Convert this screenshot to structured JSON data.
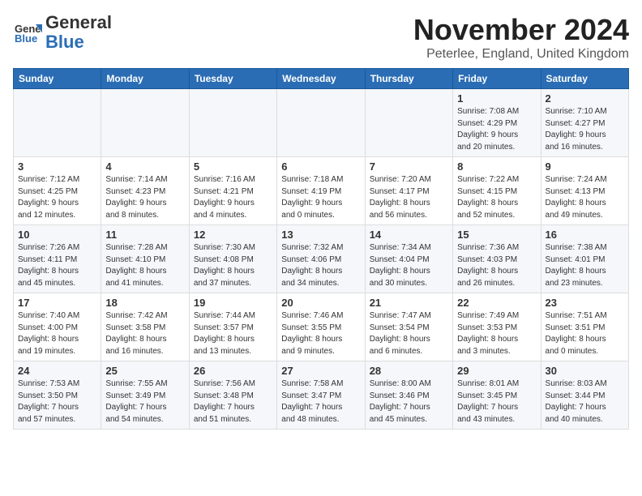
{
  "logo": {
    "line1": "General",
    "line2": "Blue"
  },
  "title": "November 2024",
  "location": "Peterlee, England, United Kingdom",
  "weekdays": [
    "Sunday",
    "Monday",
    "Tuesday",
    "Wednesday",
    "Thursday",
    "Friday",
    "Saturday"
  ],
  "weeks": [
    [
      {
        "day": "",
        "info": ""
      },
      {
        "day": "",
        "info": ""
      },
      {
        "day": "",
        "info": ""
      },
      {
        "day": "",
        "info": ""
      },
      {
        "day": "",
        "info": ""
      },
      {
        "day": "1",
        "info": "Sunrise: 7:08 AM\nSunset: 4:29 PM\nDaylight: 9 hours\nand 20 minutes."
      },
      {
        "day": "2",
        "info": "Sunrise: 7:10 AM\nSunset: 4:27 PM\nDaylight: 9 hours\nand 16 minutes."
      }
    ],
    [
      {
        "day": "3",
        "info": "Sunrise: 7:12 AM\nSunset: 4:25 PM\nDaylight: 9 hours\nand 12 minutes."
      },
      {
        "day": "4",
        "info": "Sunrise: 7:14 AM\nSunset: 4:23 PM\nDaylight: 9 hours\nand 8 minutes."
      },
      {
        "day": "5",
        "info": "Sunrise: 7:16 AM\nSunset: 4:21 PM\nDaylight: 9 hours\nand 4 minutes."
      },
      {
        "day": "6",
        "info": "Sunrise: 7:18 AM\nSunset: 4:19 PM\nDaylight: 9 hours\nand 0 minutes."
      },
      {
        "day": "7",
        "info": "Sunrise: 7:20 AM\nSunset: 4:17 PM\nDaylight: 8 hours\nand 56 minutes."
      },
      {
        "day": "8",
        "info": "Sunrise: 7:22 AM\nSunset: 4:15 PM\nDaylight: 8 hours\nand 52 minutes."
      },
      {
        "day": "9",
        "info": "Sunrise: 7:24 AM\nSunset: 4:13 PM\nDaylight: 8 hours\nand 49 minutes."
      }
    ],
    [
      {
        "day": "10",
        "info": "Sunrise: 7:26 AM\nSunset: 4:11 PM\nDaylight: 8 hours\nand 45 minutes."
      },
      {
        "day": "11",
        "info": "Sunrise: 7:28 AM\nSunset: 4:10 PM\nDaylight: 8 hours\nand 41 minutes."
      },
      {
        "day": "12",
        "info": "Sunrise: 7:30 AM\nSunset: 4:08 PM\nDaylight: 8 hours\nand 37 minutes."
      },
      {
        "day": "13",
        "info": "Sunrise: 7:32 AM\nSunset: 4:06 PM\nDaylight: 8 hours\nand 34 minutes."
      },
      {
        "day": "14",
        "info": "Sunrise: 7:34 AM\nSunset: 4:04 PM\nDaylight: 8 hours\nand 30 minutes."
      },
      {
        "day": "15",
        "info": "Sunrise: 7:36 AM\nSunset: 4:03 PM\nDaylight: 8 hours\nand 26 minutes."
      },
      {
        "day": "16",
        "info": "Sunrise: 7:38 AM\nSunset: 4:01 PM\nDaylight: 8 hours\nand 23 minutes."
      }
    ],
    [
      {
        "day": "17",
        "info": "Sunrise: 7:40 AM\nSunset: 4:00 PM\nDaylight: 8 hours\nand 19 minutes."
      },
      {
        "day": "18",
        "info": "Sunrise: 7:42 AM\nSunset: 3:58 PM\nDaylight: 8 hours\nand 16 minutes."
      },
      {
        "day": "19",
        "info": "Sunrise: 7:44 AM\nSunset: 3:57 PM\nDaylight: 8 hours\nand 13 minutes."
      },
      {
        "day": "20",
        "info": "Sunrise: 7:46 AM\nSunset: 3:55 PM\nDaylight: 8 hours\nand 9 minutes."
      },
      {
        "day": "21",
        "info": "Sunrise: 7:47 AM\nSunset: 3:54 PM\nDaylight: 8 hours\nand 6 minutes."
      },
      {
        "day": "22",
        "info": "Sunrise: 7:49 AM\nSunset: 3:53 PM\nDaylight: 8 hours\nand 3 minutes."
      },
      {
        "day": "23",
        "info": "Sunrise: 7:51 AM\nSunset: 3:51 PM\nDaylight: 8 hours\nand 0 minutes."
      }
    ],
    [
      {
        "day": "24",
        "info": "Sunrise: 7:53 AM\nSunset: 3:50 PM\nDaylight: 7 hours\nand 57 minutes."
      },
      {
        "day": "25",
        "info": "Sunrise: 7:55 AM\nSunset: 3:49 PM\nDaylight: 7 hours\nand 54 minutes."
      },
      {
        "day": "26",
        "info": "Sunrise: 7:56 AM\nSunset: 3:48 PM\nDaylight: 7 hours\nand 51 minutes."
      },
      {
        "day": "27",
        "info": "Sunrise: 7:58 AM\nSunset: 3:47 PM\nDaylight: 7 hours\nand 48 minutes."
      },
      {
        "day": "28",
        "info": "Sunrise: 8:00 AM\nSunset: 3:46 PM\nDaylight: 7 hours\nand 45 minutes."
      },
      {
        "day": "29",
        "info": "Sunrise: 8:01 AM\nSunset: 3:45 PM\nDaylight: 7 hours\nand 43 minutes."
      },
      {
        "day": "30",
        "info": "Sunrise: 8:03 AM\nSunset: 3:44 PM\nDaylight: 7 hours\nand 40 minutes."
      }
    ]
  ]
}
